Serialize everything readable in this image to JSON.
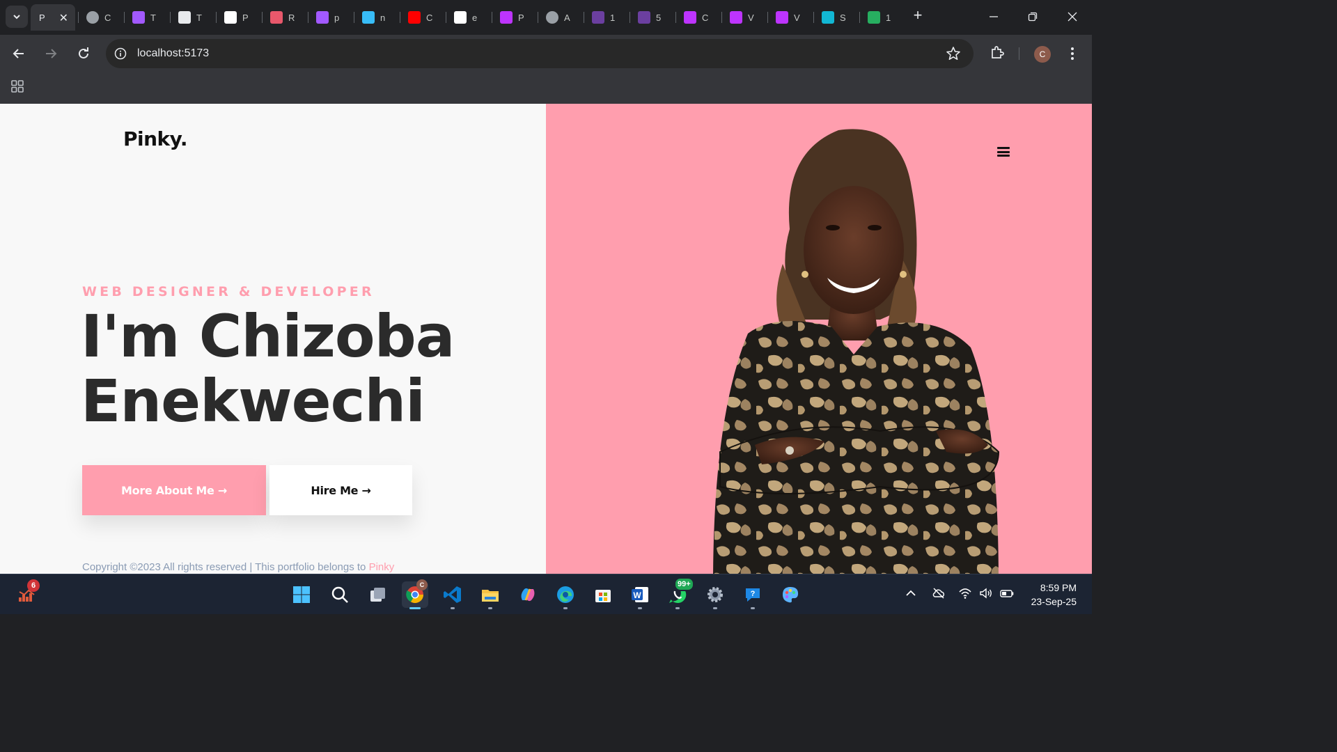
{
  "browser": {
    "tabs": [
      {
        "title": "P",
        "favicon": "page-favicon",
        "color": "#35363a",
        "active": true
      },
      {
        "title": "C",
        "favicon": "globe-icon",
        "color": "#9aa0a6"
      },
      {
        "title": "T",
        "favicon": "figma-icon",
        "color": "#a259ff"
      },
      {
        "title": "T",
        "favicon": "play-icon",
        "color": "#e8eaed"
      },
      {
        "title": "P",
        "favicon": "github-icon",
        "color": "#ffffff"
      },
      {
        "title": "R",
        "favicon": "react-icon",
        "color": "#e8586b"
      },
      {
        "title": "p",
        "favicon": "figma-icon",
        "color": "#a259ff"
      },
      {
        "title": "n",
        "favicon": "tailwind-icon",
        "color": "#38bdf8"
      },
      {
        "title": "C",
        "favicon": "youtube-icon",
        "color": "#ff0000"
      },
      {
        "title": "e",
        "favicon": "angular-icon",
        "color": "#ffffff"
      },
      {
        "title": "P",
        "favicon": "vite-icon",
        "color": "#bd34fe"
      },
      {
        "title": "A",
        "favicon": "globe-icon",
        "color": "#9aa0a6"
      },
      {
        "title": "1",
        "favicon": "colorlib-icon",
        "color": "#6b3fa0"
      },
      {
        "title": "5",
        "favicon": "colorlib-icon",
        "color": "#6b3fa0"
      },
      {
        "title": "C",
        "favicon": "vite-icon",
        "color": "#bd34fe"
      },
      {
        "title": "V",
        "favicon": "vite-icon",
        "color": "#bd34fe"
      },
      {
        "title": "V",
        "favicon": "vite-icon",
        "color": "#bd34fe"
      },
      {
        "title": "S",
        "favicon": "s-app-icon",
        "color": "#12b7d4"
      },
      {
        "title": "1",
        "favicon": "green-app-icon",
        "color": "#27ae60"
      }
    ],
    "url": "localhost:5173",
    "profile_initial": "C"
  },
  "page": {
    "logo": "Pinky.",
    "subtitle": "WEB DESIGNER & DEVELOPER",
    "heading_line1": "I'm Chizoba",
    "heading_line2": "Enekwechi",
    "primary_button": "More About Me →",
    "secondary_button": "Hire Me →",
    "copyright_text": "Copyright ©2023 All rights reserved | This portfolio belongs to ",
    "copyright_link": "Pinky",
    "accent_color": "#ff9eae"
  },
  "taskbar": {
    "widget_badge": "6",
    "chrome_badge": "C",
    "whatsapp_badge": "99+",
    "apps": [
      "start-icon",
      "search-icon",
      "task-view-icon",
      "chrome-icon",
      "vscode-icon",
      "file-explorer-icon",
      "copilot-icon",
      "edge-icon",
      "store-icon",
      "word-icon",
      "whatsapp-icon",
      "settings-icon",
      "help-icon",
      "paint-icon"
    ],
    "time": "8:59 PM",
    "date": "23-Sep-25"
  }
}
